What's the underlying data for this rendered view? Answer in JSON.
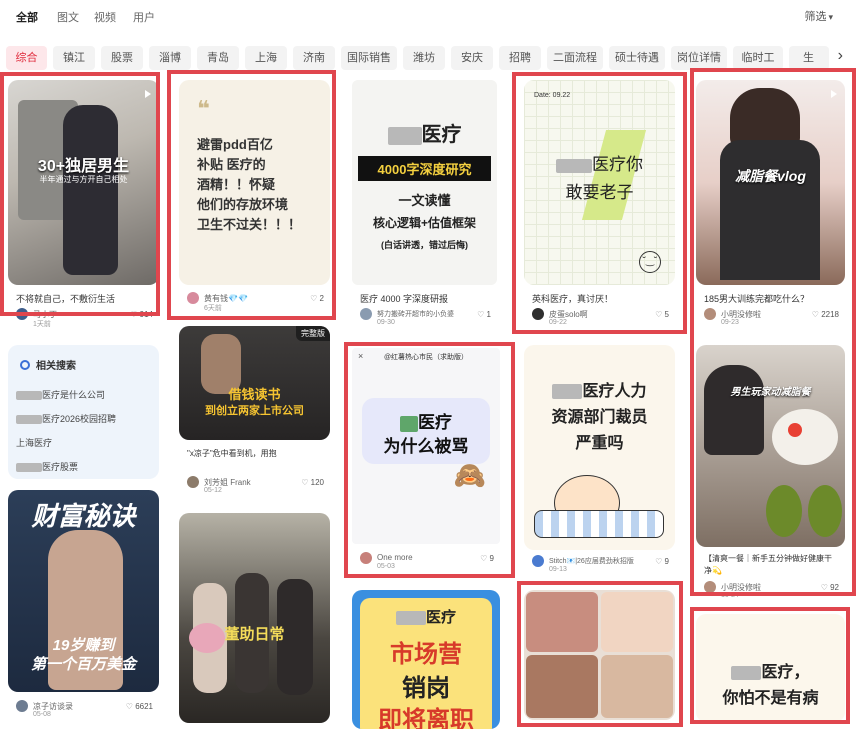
{
  "tabs": [
    "全部",
    "图文",
    "视频",
    "用户"
  ],
  "filter_label": "筛选",
  "categories": [
    "综合",
    "镇江",
    "股票",
    "淄博",
    "青岛",
    "上海",
    "济南",
    "国际销售",
    "潍坊",
    "安庆",
    "招聘",
    "二面流程",
    "硕士待遇",
    "岗位详情",
    "临时工",
    "生"
  ],
  "related": {
    "heading": "相关搜索",
    "items": [
      "医疗是什么公司",
      "医疗2026校园招聘",
      "上海医疗",
      "医疗股票"
    ]
  },
  "cards": [
    {
      "id": "c1",
      "title": "不将就自己，不敷衍生活",
      "author": "马小丁",
      "date": "1天前",
      "likes": "914",
      "overlay": "30+独居男生",
      "overlay_sub": "半年通过与方开自己相处"
    },
    {
      "id": "c2",
      "title": "",
      "author": "黄有钱💎💎",
      "date": "6天前",
      "likes": "2",
      "art_lines": [
        "避雷pdd百亿",
        "补贴 医疗的",
        "酒精！！怀疑",
        "他们的存放环境",
        "卫生不过关！！！"
      ]
    },
    {
      "id": "c3",
      "title": "医疗 4000 字深度研报",
      "author": "努力搬砖开超市的小负婆",
      "date": "09-30",
      "likes": "1",
      "art_lines": [
        "医疗",
        "4000字深度研究",
        "一文读懂",
        "核心逻辑+估值框架",
        "(白话讲透，错过后悔)"
      ]
    },
    {
      "id": "c4",
      "title": "英科医疗，真讨厌！",
      "author": "皮蛋solo啊",
      "date": "09-22",
      "likes": "5",
      "note_date": "Date: 09.22",
      "art_lines": [
        "医疗你",
        "敢要老子"
      ]
    },
    {
      "id": "c5",
      "title": "185男大训练完都吃什么？",
      "author": "小明没修啦",
      "date": "09-23",
      "likes": "2218",
      "overlay": "减脂餐vlog"
    },
    {
      "id": "c6",
      "title": "\"x凉子\"危中看到机，用抱",
      "author": "刘芳姐 Frank",
      "date": "05-12",
      "likes": "120",
      "badge": "完整版",
      "overlay_lines": [
        "借钱读书",
        "到创立两家上市公司"
      ]
    },
    {
      "id": "c7",
      "title": "",
      "author": "One more",
      "date": "05-03",
      "likes": "9",
      "header": "@红薯热心市民（求助版）",
      "art_lines": [
        "医疗",
        "为什么被骂"
      ]
    },
    {
      "id": "c8",
      "title": "",
      "author": "Stitch📧|26应届费劲秋招版",
      "date": "09-13",
      "likes": "9",
      "art_lines": [
        "医疗人力",
        "资源部门裁员",
        "严重吗"
      ]
    },
    {
      "id": "c9",
      "title": "【清爽一餐｜新手五分钟做好健康干净💫",
      "author": "小明没修啦",
      "date": "10-24",
      "likes": "92",
      "overlay": "男生玩家动减脂餐"
    },
    {
      "id": "c10",
      "title": "",
      "author": "凉子访谈录",
      "date": "05-08",
      "likes": "6621",
      "overlay": "财富秘诀",
      "overlay_lines": [
        "19岁赚到",
        "第一个百万美金"
      ]
    },
    {
      "id": "c11",
      "title": "",
      "author": "",
      "date": "",
      "likes": "",
      "overlay": "董助日常"
    },
    {
      "id": "c12",
      "title": "",
      "author": "",
      "date": "",
      "likes": "",
      "art_lines": [
        "医疗",
        "市场营",
        "销岗",
        "即将离职"
      ]
    },
    {
      "id": "c13",
      "title": "",
      "author": "",
      "date": "",
      "likes": "",
      "art_lines": []
    },
    {
      "id": "c14",
      "title": "",
      "author": "",
      "date": "",
      "likes": "",
      "art_lines": [
        "医疗，",
        "你怕不是有病"
      ]
    }
  ],
  "colors": {
    "accent": "#e0464e",
    "active_cat_bg": "#fde7ea",
    "active_cat_text": "#e02e3f"
  }
}
